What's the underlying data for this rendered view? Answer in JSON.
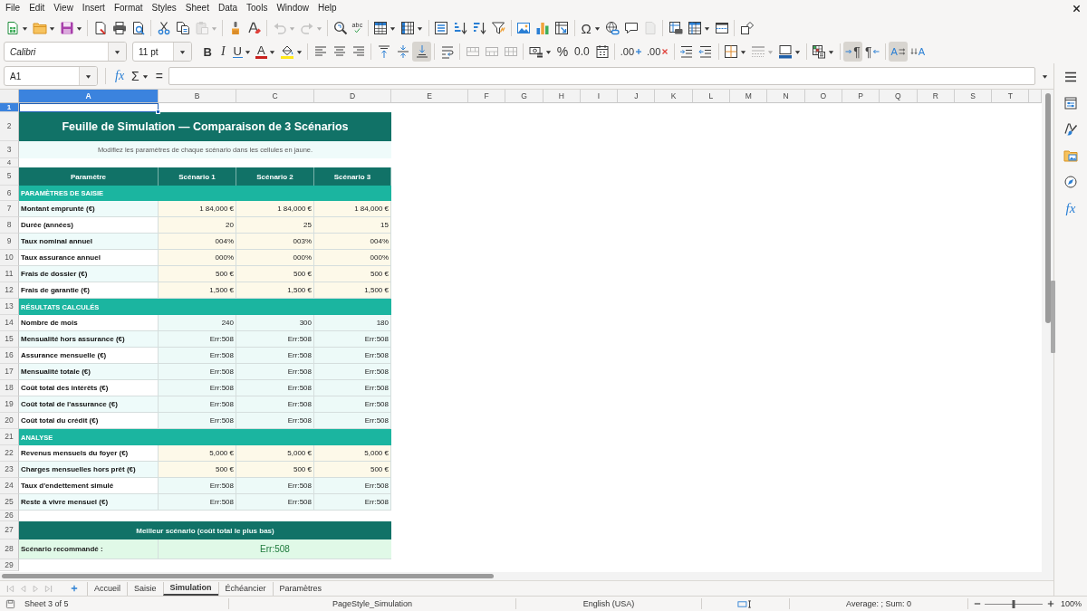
{
  "menu_bar": [
    "File",
    "Edit",
    "View",
    "Insert",
    "Format",
    "Styles",
    "Sheet",
    "Data",
    "Tools",
    "Window",
    "Help"
  ],
  "standard_toolbar": [
    [
      {
        "kind": "new",
        "disabled": false
      },
      {
        "kind": "open",
        "disabled": false
      },
      {
        "kind": "save",
        "disabled": false
      }
    ],
    [
      {
        "kind": "pdf",
        "disabled": false
      },
      {
        "kind": "print",
        "disabled": false
      },
      {
        "kind": "preview",
        "disabled": false
      }
    ],
    [
      {
        "kind": "cut",
        "disabled": false
      },
      {
        "kind": "copy",
        "disabled": false
      },
      {
        "kind": "paste",
        "disabled": true
      }
    ],
    [
      {
        "kind": "clone",
        "disabled": false
      },
      {
        "kind": "clear",
        "disabled": false
      }
    ],
    [
      {
        "kind": "undo",
        "disabled": true
      },
      {
        "kind": "redo",
        "disabled": true
      }
    ],
    [
      {
        "kind": "find",
        "disabled": false
      },
      {
        "kind": "spelling",
        "label": "abc",
        "disabled": false
      }
    ],
    [
      {
        "kind": "rows",
        "disabled": false
      },
      {
        "kind": "columns",
        "disabled": false
      }
    ],
    [
      {
        "kind": "sort",
        "disabled": false
      },
      {
        "kind": "ascending",
        "disabled": false
      },
      {
        "kind": "descending",
        "disabled": false
      },
      {
        "kind": "filter",
        "disabled": false
      }
    ],
    [
      {
        "kind": "image",
        "disabled": false
      },
      {
        "kind": "chart",
        "disabled": false
      },
      {
        "kind": "pivot",
        "disabled": false
      }
    ],
    [
      {
        "kind": "symbol",
        "label": "Ω",
        "disabled": false
      },
      {
        "kind": "hyperlink",
        "disabled": false
      },
      {
        "kind": "comment",
        "disabled": false
      },
      {
        "kind": "headers",
        "disabled": true
      }
    ],
    [
      {
        "kind": "area",
        "disabled": false
      },
      {
        "kind": "freeze",
        "disabled": false
      },
      {
        "kind": "split",
        "disabled": false
      }
    ],
    [
      {
        "kind": "draw",
        "disabled": false
      }
    ]
  ],
  "formatting_toolbar": {
    "font_name": "Calibri",
    "font_size": "11 pt",
    "groups": [
      [
        {
          "kind": "bold",
          "label": "B",
          "on": false,
          "disabled": false
        },
        {
          "kind": "italic",
          "label": "I",
          "on": false,
          "disabled": false
        },
        {
          "kind": "underline",
          "label": "U",
          "on": false,
          "disabled": false
        },
        {
          "kind": "color",
          "label": "A",
          "on": false,
          "disabled": false
        },
        {
          "kind": "highlight",
          "on": false,
          "disabled": false
        }
      ],
      [
        {
          "kind": "left",
          "on": false,
          "disabled": false
        },
        {
          "kind": "center",
          "on": false,
          "disabled": false
        },
        {
          "kind": "right",
          "on": false,
          "disabled": false
        }
      ],
      [
        {
          "kind": "top",
          "on": false,
          "disabled": false
        },
        {
          "kind": "middle",
          "on": false,
          "disabled": false
        },
        {
          "kind": "bottom",
          "on": true,
          "disabled": false
        }
      ],
      [
        {
          "kind": "wrap",
          "on": false,
          "disabled": false
        }
      ],
      [
        {
          "kind": "mergecenter",
          "on": false,
          "disabled": true
        },
        {
          "kind": "merge",
          "on": false,
          "disabled": true
        },
        {
          "kind": "unmerge",
          "on": false,
          "disabled": true
        }
      ],
      [
        {
          "kind": "currency",
          "on": false,
          "disabled": false
        },
        {
          "kind": "percent",
          "label": "%",
          "on": false,
          "disabled": false
        },
        {
          "kind": "number",
          "label": "0.0",
          "on": false,
          "disabled": false
        },
        {
          "kind": "date",
          "on": false,
          "disabled": false
        }
      ],
      [
        {
          "kind": "adddecimal",
          "label": ".00",
          "on": false,
          "disabled": false
        },
        {
          "kind": "deldecimal",
          "label": ".00",
          "on": false,
          "disabled": false
        }
      ],
      [
        {
          "kind": "indent",
          "on": false,
          "disabled": false
        },
        {
          "kind": "outdent",
          "on": false,
          "disabled": false
        }
      ],
      [
        {
          "kind": "borders",
          "on": false,
          "disabled": false
        },
        {
          "kind": "linestyle",
          "on": false,
          "disabled": true
        },
        {
          "kind": "bordercolor",
          "on": false,
          "disabled": false
        }
      ],
      [
        {
          "kind": "conditional",
          "on": false,
          "disabled": false
        }
      ],
      [
        {
          "kind": "ltr",
          "label": "¶",
          "on": true,
          "disabled": false
        },
        {
          "kind": "rtl",
          "label": "¶",
          "on": false,
          "disabled": false
        }
      ],
      [
        {
          "kind": "horizontal",
          "label": "A",
          "on": true,
          "disabled": false
        },
        {
          "kind": "vertical",
          "label": "A",
          "on": false,
          "disabled": false
        }
      ]
    ]
  },
  "formula_bar": {
    "cell_reference": "A1",
    "function_wizard": "fx",
    "sum": "Σ",
    "formula": "="
  },
  "sheet": {
    "columns": [
      {
        "label": "A",
        "selected": true
      },
      {
        "label": "B",
        "selected": false
      },
      {
        "label": "C",
        "selected": false
      },
      {
        "label": "D",
        "selected": false
      },
      {
        "label": "E",
        "selected": false
      },
      {
        "label": "F",
        "selected": false
      },
      {
        "label": "G",
        "selected": false
      },
      {
        "label": "H",
        "selected": false
      },
      {
        "label": "I",
        "selected": false
      },
      {
        "label": "J",
        "selected": false
      },
      {
        "label": "K",
        "selected": false
      },
      {
        "label": "L",
        "selected": false
      },
      {
        "label": "M",
        "selected": false
      },
      {
        "label": "N",
        "selected": false
      },
      {
        "label": "O",
        "selected": false
      },
      {
        "label": "P",
        "selected": false
      },
      {
        "label": "Q",
        "selected": false
      },
      {
        "label": "R",
        "selected": false
      },
      {
        "label": "S",
        "selected": false
      },
      {
        "label": "T",
        "selected": false
      }
    ],
    "rows": [
      {
        "number": "1",
        "kind": "blank",
        "selected": true
      },
      {
        "number": "2",
        "kind": "title",
        "selected": false,
        "cells": [
          "Feuille de Simulation — Comparaison de 3 Scénarios"
        ]
      },
      {
        "number": "3",
        "kind": "note",
        "selected": false,
        "cells": [
          "Modifiez les paramètres de chaque scénario dans les cellules en jaune."
        ]
      },
      {
        "number": "4",
        "kind": "blank",
        "selected": false
      },
      {
        "number": "5",
        "kind": "header",
        "selected": false,
        "cells": [
          "Paramètre",
          "Scénario 1",
          "Scénario 2",
          "Scénario 3"
        ]
      },
      {
        "number": "6",
        "kind": "section",
        "selected": false,
        "cells": [
          "PARAMÈTRES DE SAISIE"
        ]
      },
      {
        "number": "7",
        "kind": "input",
        "selected": false,
        "shaded": true,
        "cells": [
          "Montant emprunté (€)",
          "1 84,000 €",
          "1 84,000 €",
          "1 84,000 €"
        ]
      },
      {
        "number": "8",
        "kind": "input",
        "selected": false,
        "shaded": false,
        "cells": [
          "Durée (années)",
          "20",
          "25",
          "15"
        ]
      },
      {
        "number": "9",
        "kind": "input",
        "selected": false,
        "shaded": true,
        "cells": [
          "Taux nominal annuel",
          "004%",
          "003%",
          "004%"
        ]
      },
      {
        "number": "10",
        "kind": "input",
        "selected": false,
        "shaded": false,
        "cells": [
          "Taux assurance annuel",
          "000%",
          "000%",
          "000%"
        ]
      },
      {
        "number": "11",
        "kind": "input",
        "selected": false,
        "shaded": true,
        "cells": [
          "Frais de dossier (€)",
          "500 €",
          "500 €",
          "500 €"
        ]
      },
      {
        "number": "12",
        "kind": "input",
        "selected": false,
        "shaded": false,
        "cells": [
          "Frais de garantie (€)",
          "1,500 €",
          "1,500 €",
          "1,500 €"
        ]
      },
      {
        "number": "13",
        "kind": "section",
        "selected": false,
        "cells": [
          "RÉSULTATS CALCULÉS"
        ]
      },
      {
        "number": "14",
        "kind": "result",
        "selected": false,
        "shaded": false,
        "cells": [
          "Nombre de mois",
          "240",
          "300",
          "180"
        ]
      },
      {
        "number": "15",
        "kind": "result",
        "selected": false,
        "shaded": true,
        "cells": [
          "Mensualité hors assurance (€)",
          "Err:508",
          "Err:508",
          "Err:508"
        ]
      },
      {
        "number": "16",
        "kind": "result",
        "selected": false,
        "shaded": false,
        "cells": [
          "Assurance mensuelle (€)",
          "Err:508",
          "Err:508",
          "Err:508"
        ]
      },
      {
        "number": "17",
        "kind": "result",
        "selected": false,
        "shaded": true,
        "cells": [
          "Mensualité totale (€)",
          "Err:508",
          "Err:508",
          "Err:508"
        ]
      },
      {
        "number": "18",
        "kind": "result",
        "selected": false,
        "shaded": false,
        "cells": [
          "Coût total des intérêts (€)",
          "Err:508",
          "Err:508",
          "Err:508"
        ]
      },
      {
        "number": "19",
        "kind": "result",
        "selected": false,
        "shaded": true,
        "cells": [
          "Coût total de l'assurance (€)",
          "Err:508",
          "Err:508",
          "Err:508"
        ]
      },
      {
        "number": "20",
        "kind": "result",
        "selected": false,
        "shaded": false,
        "cells": [
          "Coût total du crédit (€)",
          "Err:508",
          "Err:508",
          "Err:508"
        ]
      },
      {
        "number": "21",
        "kind": "section",
        "selected": false,
        "cells": [
          "ANALYSE"
        ]
      },
      {
        "number": "22",
        "kind": "input",
        "selected": false,
        "shaded": false,
        "cells": [
          "Revenus mensuels du foyer (€)",
          "5,000 €",
          "5,000 €",
          "5,000 €"
        ]
      },
      {
        "number": "23",
        "kind": "input",
        "selected": false,
        "shaded": true,
        "cells": [
          "Charges mensuelles hors prêt (€)",
          "500 €",
          "500 €",
          "500 €"
        ]
      },
      {
        "number": "24",
        "kind": "result",
        "selected": false,
        "shaded": false,
        "cells": [
          "Taux d'endettement simulé",
          "Err:508",
          "Err:508",
          "Err:508"
        ]
      },
      {
        "number": "25",
        "kind": "result",
        "selected": false,
        "shaded": true,
        "cells": [
          "Reste à vivre mensuel (€)",
          "Err:508",
          "Err:508",
          "Err:508"
        ]
      },
      {
        "number": "26",
        "kind": "blank",
        "selected": false
      },
      {
        "number": "27",
        "kind": "banner",
        "selected": false,
        "cells": [
          "Meilleur scénario (coût total le plus bas)"
        ]
      },
      {
        "number": "28",
        "kind": "recommendation",
        "selected": false,
        "cells": [
          "Scénario recommandé :",
          "Err:508"
        ]
      },
      {
        "number": "29",
        "kind": "blank",
        "selected": false
      }
    ]
  },
  "sheet_navigation": [
    {
      "kind": "first",
      "disabled": true
    },
    {
      "kind": "previous",
      "disabled": true
    },
    {
      "kind": "next",
      "disabled": true
    },
    {
      "kind": "last",
      "disabled": true
    }
  ],
  "sheet_tabs": [
    {
      "label": "Accueil",
      "selected": false
    },
    {
      "label": "Saisie",
      "selected": false
    },
    {
      "label": "Simulation",
      "selected": true
    },
    {
      "label": "Échéancier",
      "selected": false
    },
    {
      "label": "Paramètres",
      "selected": false
    }
  ],
  "sidebar": {
    "tabs": [
      {
        "kind": "properties",
        "selected": false
      },
      {
        "kind": "styles",
        "selected": false
      },
      {
        "kind": "gallery",
        "selected": false
      },
      {
        "kind": "navigator",
        "selected": false
      },
      {
        "kind": "functions",
        "label": "fx",
        "selected": false
      }
    ]
  },
  "status_bar": {
    "sheet": "Sheet 3 of 5",
    "page_style": "PageStyle_Simulation",
    "language": "English (USA)",
    "summary": "Average: ; Sum: 0",
    "zoom": {
      "level": 0.5,
      "reading": "100%"
    }
  }
}
